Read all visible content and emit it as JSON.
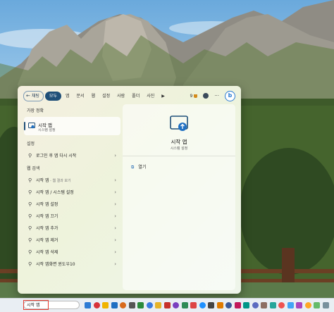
{
  "search_panel": {
    "filters": {
      "back_label": "채팅",
      "chips": [
        "모두",
        "앱",
        "문서",
        "웹",
        "설정",
        "사람",
        "폴더",
        "사진"
      ],
      "active_chip": "모두",
      "score": "9"
    },
    "best_match": {
      "section_title": "가장 정확",
      "title": "시작 앱",
      "subtitle": "시스템 설정"
    },
    "settings": {
      "section_title": "설정",
      "items": [
        {
          "label": "로그인 후 앱 다시 시작"
        }
      ]
    },
    "web_search": {
      "section_title": "웹 검색",
      "items": [
        {
          "label": "시작 앱",
          "sub": " - 웹 결과 보기"
        },
        {
          "label": "시작 앱 / 시스템 설정",
          "sub": ""
        },
        {
          "label": "시작 앱 설정",
          "sub": ""
        },
        {
          "label": "시작 앱 끄기",
          "sub": ""
        },
        {
          "label": "시작 앱 추가",
          "sub": ""
        },
        {
          "label": "시작 앱 제거",
          "sub": ""
        },
        {
          "label": "시작 앱 삭제",
          "sub": ""
        },
        {
          "label": "시작 앱화면 윈도우10",
          "sub": ""
        }
      ]
    },
    "detail": {
      "title": "시작 앱",
      "subtitle": "시스템 설정",
      "action_open": "열기"
    }
  },
  "taskbar": {
    "search_value": "시작 앱",
    "icon_colors": [
      "#2d7bd4",
      "#d8333a",
      "#f0b400",
      "#1f6fc2",
      "#d86a1d",
      "#555555",
      "#2a8a3b",
      "#3a7be0",
      "#e6b42a",
      "#c7302a",
      "#7a3fbf",
      "#2e8b57",
      "#d44",
      "#1e90ff",
      "#444",
      "#e07b00",
      "#3b5998",
      "#c2185b",
      "#009688",
      "#5c6bc0",
      "#8d6e63",
      "#26a69a",
      "#ef5350",
      "#42a5f5",
      "#ab47bc",
      "#ffa726",
      "#66bb6a",
      "#78909c"
    ]
  },
  "colors": {
    "accent": "#1f4f78",
    "selection_highlight": "#e53b2f"
  }
}
